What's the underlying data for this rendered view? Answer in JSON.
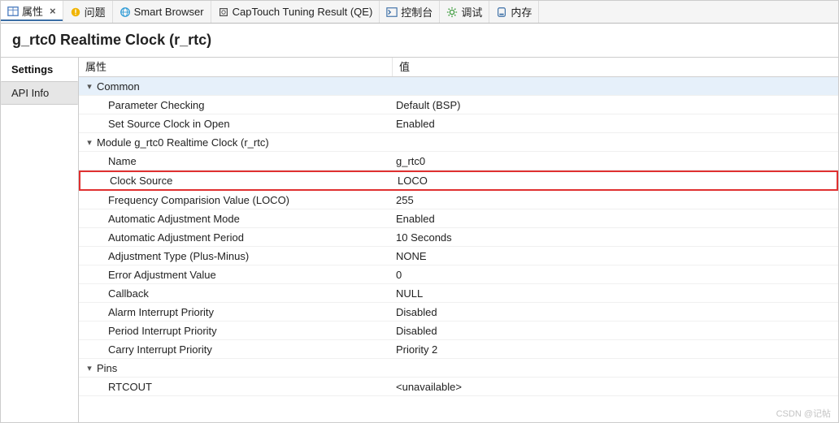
{
  "tabs": [
    {
      "key": "props",
      "label": "属性",
      "icon": "table-icon",
      "active": true,
      "closable": true
    },
    {
      "key": "probs",
      "label": "问题",
      "icon": "warn-icon",
      "active": false,
      "closable": false
    },
    {
      "key": "smart",
      "label": "Smart Browser",
      "icon": "globe-icon",
      "active": false,
      "closable": false
    },
    {
      "key": "ctune",
      "label": "CapTouch Tuning Result (QE)",
      "icon": "chip-icon",
      "active": false,
      "closable": false
    },
    {
      "key": "console",
      "label": "控制台",
      "icon": "console-icon",
      "active": false,
      "closable": false
    },
    {
      "key": "debug",
      "label": "调试",
      "icon": "gear-icon",
      "active": false,
      "closable": false
    },
    {
      "key": "memory",
      "label": "内存",
      "icon": "disk-icon",
      "active": false,
      "closable": false
    }
  ],
  "header": {
    "title": "g_rtc0 Realtime Clock (r_rtc)"
  },
  "sidebar": {
    "settings_label": "Settings",
    "api_info_label": "API Info"
  },
  "columns": {
    "property": "属性",
    "value": "值"
  },
  "groups": [
    {
      "label": "Common",
      "selected": true,
      "rows": [
        {
          "name": "Parameter Checking",
          "value": "Default (BSP)"
        },
        {
          "name": "Set Source Clock in Open",
          "value": "Enabled"
        }
      ]
    },
    {
      "label": "Module g_rtc0 Realtime Clock (r_rtc)",
      "rows": [
        {
          "name": "Name",
          "value": "g_rtc0"
        },
        {
          "name": "Clock Source",
          "value": "LOCO",
          "highlight": true
        },
        {
          "name": "Frequency Comparision Value (LOCO)",
          "value": "255"
        },
        {
          "name": "Automatic Adjustment Mode",
          "value": "Enabled"
        },
        {
          "name": "Automatic Adjustment Period",
          "value": "10 Seconds"
        },
        {
          "name": "Adjustment Type (Plus-Minus)",
          "value": "NONE"
        },
        {
          "name": "Error Adjustment Value",
          "value": "0"
        },
        {
          "name": "Callback",
          "value": "NULL"
        },
        {
          "name": "Alarm Interrupt Priority",
          "value": "Disabled"
        },
        {
          "name": "Period Interrupt Priority",
          "value": "Disabled"
        },
        {
          "name": "Carry Interrupt Priority",
          "value": "Priority 2"
        }
      ]
    },
    {
      "label": "Pins",
      "rows": [
        {
          "name": "RTCOUT",
          "value": "<unavailable>"
        }
      ]
    }
  ],
  "watermark": "CSDN @记帖"
}
